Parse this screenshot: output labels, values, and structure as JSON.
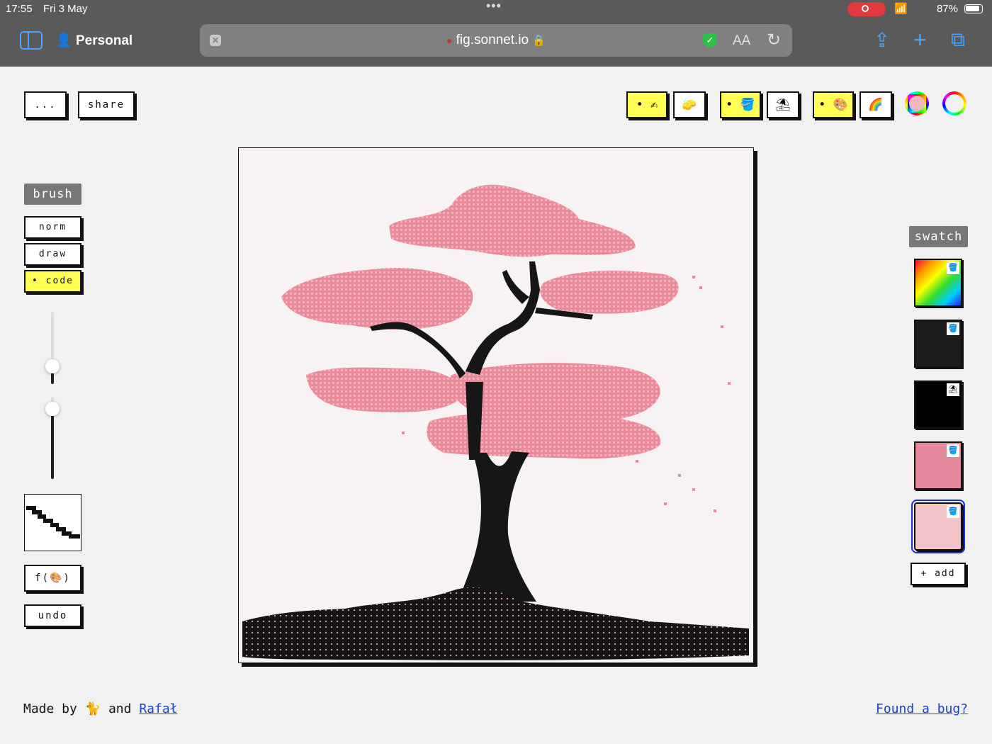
{
  "status_bar": {
    "time": "17:55",
    "date": "Fri 3 May",
    "battery": "87%"
  },
  "browser": {
    "profile": "Personal",
    "url": "fig.sonnet.io",
    "aa": "AA"
  },
  "app": {
    "menu_label": "...",
    "share_label": "share",
    "brush_section": "brush",
    "brush_modes": [
      "norm",
      "draw",
      "code"
    ],
    "active_brush_mode": "code",
    "function_label": "f(🎨)",
    "undo_label": "undo",
    "swatch_section": "swatch",
    "add_label": "+ add",
    "tools": [
      {
        "name": "pencil-tool",
        "glyph": "✍",
        "active": true
      },
      {
        "name": "eraser-tool",
        "glyph": "🧽",
        "active": false
      },
      {
        "name": "brush-bucket-tool",
        "glyph": "🪣",
        "active": true
      },
      {
        "name": "picker-tool",
        "glyph": "⛱",
        "active": false
      },
      {
        "name": "palette-tool",
        "glyph": "🎨",
        "active": true
      },
      {
        "name": "rainbow-tool",
        "glyph": "🌈",
        "active": false
      }
    ],
    "size_slider_level": 0.25,
    "opacity_slider_level": 0.85,
    "swatches": [
      {
        "name": "rainbow-swatch",
        "color": "rainbow",
        "badge": "🪣",
        "selected": false
      },
      {
        "name": "dark-gray-swatch",
        "color": "#1c1c1c",
        "badge": "🪣",
        "selected": false
      },
      {
        "name": "black-swatch",
        "color": "#000000",
        "badge": "⛱",
        "selected": false
      },
      {
        "name": "pink-swatch",
        "color": "#e6899c",
        "badge": "🪣",
        "selected": false
      },
      {
        "name": "light-pink-swatch",
        "color": "#f0c4c8",
        "badge": "🪣",
        "selected": true
      }
    ],
    "colors": {
      "accent_yellow": "#ffff55",
      "blossom_pink": "#e6899c",
      "trunk_black": "#161616",
      "link_blue": "#1a3fd1"
    }
  },
  "footer": {
    "made_by": "Made by",
    "emoji": "🐈",
    "and": "and",
    "author_link": "Rafał",
    "bug_link": "Found a bug?"
  }
}
